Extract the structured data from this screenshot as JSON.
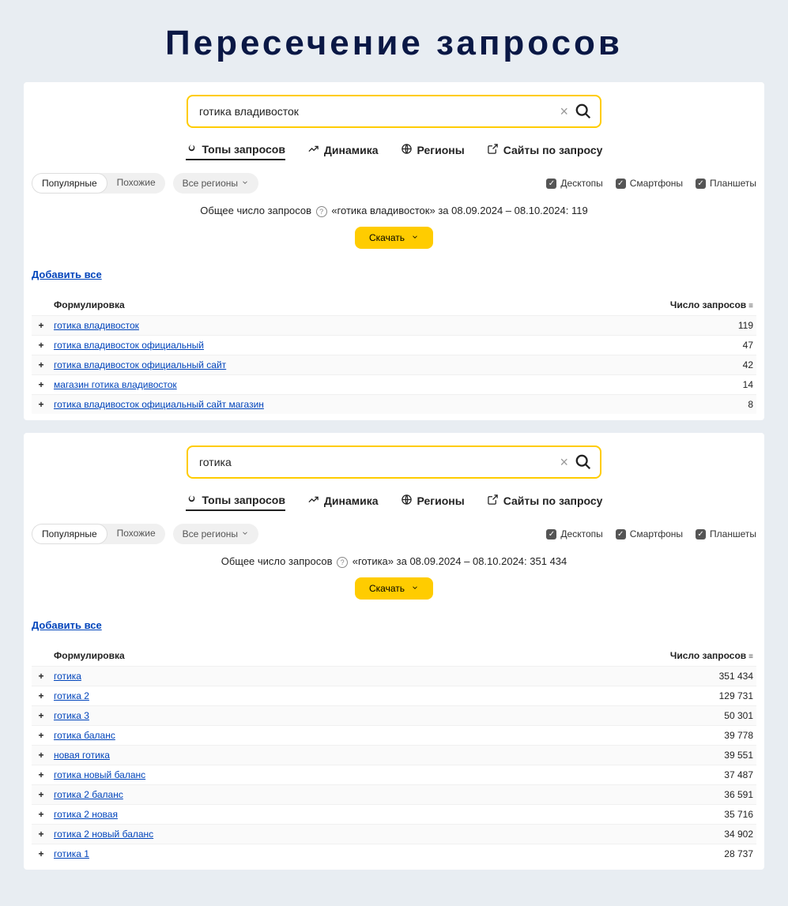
{
  "page_title": "Пересечение запросов",
  "panels": [
    {
      "search": {
        "value": "готика владивосток"
      },
      "stats": {
        "prefix": "Общее число запросов",
        "query": "«готика владивосток»",
        "period": "за 08.09.2024 – 08.10.2024:",
        "total": "119"
      },
      "rows": [
        {
          "phrase": "готика владивосток",
          "count": "119"
        },
        {
          "phrase": "готика владивосток официальный",
          "count": "47"
        },
        {
          "phrase": "готика владивосток официальный сайт",
          "count": "42"
        },
        {
          "phrase": "магазин готика владивосток",
          "count": "14"
        },
        {
          "phrase": "готика владивосток официальный сайт магазин",
          "count": "8"
        }
      ]
    },
    {
      "search": {
        "value": "готика"
      },
      "stats": {
        "prefix": "Общее число запросов",
        "query": "«готика»",
        "period": "за 08.09.2024 – 08.10.2024:",
        "total": "351 434"
      },
      "rows": [
        {
          "phrase": "готика",
          "count": "351 434"
        },
        {
          "phrase": "готика 2",
          "count": "129 731"
        },
        {
          "phrase": "готика 3",
          "count": "50 301"
        },
        {
          "phrase": "готика баланс",
          "count": "39 778"
        },
        {
          "phrase": "новая готика",
          "count": "39 551"
        },
        {
          "phrase": "готика новый баланс",
          "count": "37 487"
        },
        {
          "phrase": "готика 2 баланс",
          "count": "36 591"
        },
        {
          "phrase": "готика 2 новая",
          "count": "35 716"
        },
        {
          "phrase": "готика 2 новый баланс",
          "count": "34 902"
        },
        {
          "phrase": "готика 1",
          "count": "28 737"
        }
      ]
    }
  ],
  "tabs": [
    {
      "label": "Топы запросов",
      "icon": "fire",
      "active": true
    },
    {
      "label": "Динамика",
      "icon": "trend",
      "active": false
    },
    {
      "label": "Регионы",
      "icon": "globe",
      "active": false
    },
    {
      "label": "Сайты по запросу",
      "icon": "external",
      "active": false
    }
  ],
  "filters": {
    "seg": [
      {
        "label": "Популярные",
        "active": true
      },
      {
        "label": "Похожие",
        "active": false
      }
    ],
    "region": "Все регионы",
    "devices": [
      {
        "label": "Десктопы"
      },
      {
        "label": "Смартфоны"
      },
      {
        "label": "Планшеты"
      }
    ]
  },
  "labels": {
    "download": "Скачать",
    "add_all": "Добавить все",
    "col_phrase": "Формулировка",
    "col_count": "Число запросов"
  }
}
